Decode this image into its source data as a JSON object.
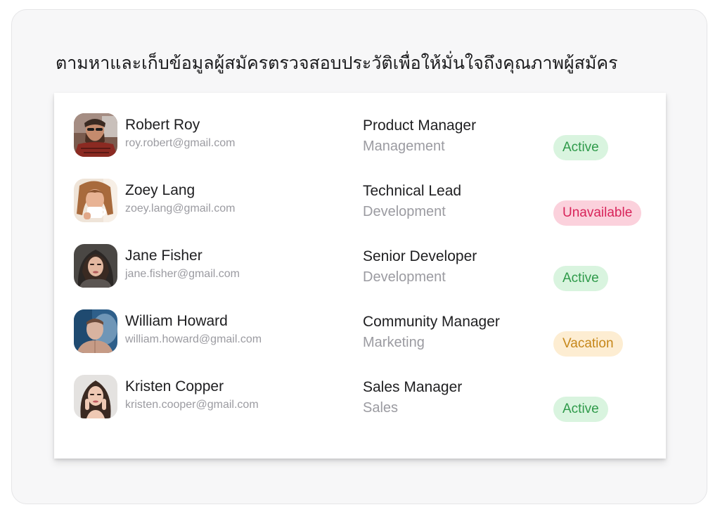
{
  "headline": "ตามหาและเก็บข้อมูลผู้สมัครตรวจสอบประวัติเพื่อให้มั่นใจถึงคุณภาพผู้สมัคร",
  "colors": {
    "active_bg": "#d9f4df",
    "active_text": "#2f9a4a",
    "unavailable_bg": "#fbd1dc",
    "unavailable_text": "#d8245a",
    "vacation_bg": "#fdedd2",
    "vacation_text": "#c6871a"
  },
  "candidates": [
    {
      "name": "Robert Roy",
      "email": "roy.robert@gmail.com",
      "role": "Product Manager",
      "department": "Management",
      "status": "Active",
      "avatar": "bearded-man-avatar"
    },
    {
      "name": "Zoey Lang",
      "email": "zoey.lang@gmail.com",
      "role": "Technical Lead",
      "department": "Development",
      "status": "Unavailable",
      "avatar": "woman-with-cup-avatar"
    },
    {
      "name": "Jane Fisher",
      "email": "jane.fisher@gmail.com",
      "role": "Senior Developer",
      "department": "Development",
      "status": "Active",
      "avatar": "woman-with-headscarf-avatar"
    },
    {
      "name": "William Howard",
      "email": "william.howard@gmail.com",
      "role": "Community Manager",
      "department": "Marketing",
      "status": "Vacation",
      "avatar": "man-with-smoke-avatar"
    },
    {
      "name": "Kristen Copper",
      "email": "kristen.cooper@gmail.com",
      "role": "Sales Manager",
      "department": "Sales",
      "status": "Active",
      "avatar": "woman-portrait-avatar"
    }
  ]
}
